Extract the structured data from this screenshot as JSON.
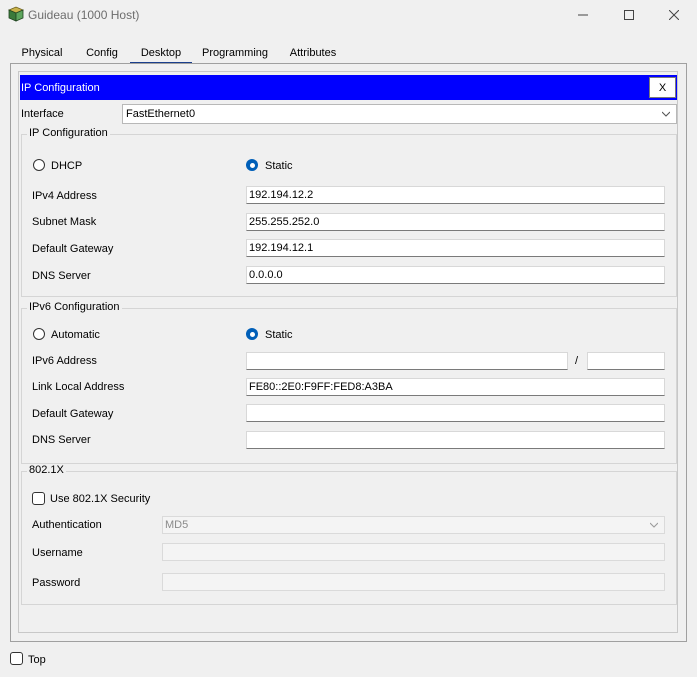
{
  "window": {
    "title": "Guideau (1000 Host)",
    "minimize_icon": "minimize-icon",
    "maximize_icon": "maximize-icon",
    "close_icon": "close-icon"
  },
  "tabs": [
    {
      "label": "Physical",
      "active": false
    },
    {
      "label": "Config",
      "active": false
    },
    {
      "label": "Desktop",
      "active": true
    },
    {
      "label": "Programming",
      "active": false
    },
    {
      "label": "Attributes",
      "active": false
    }
  ],
  "panel": {
    "header_title": "IP Configuration",
    "close_label": "X",
    "header_color": "#0000ff"
  },
  "interface": {
    "label": "Interface",
    "value": "FastEthernet0"
  },
  "ipv4": {
    "group_title": "IP Configuration",
    "dhcp_label": "DHCP",
    "static_label": "Static",
    "mode": "static",
    "address_label": "IPv4 Address",
    "address_value": "192.194.12.2",
    "mask_label": "Subnet Mask",
    "mask_value": "255.255.252.0",
    "gateway_label": "Default Gateway",
    "gateway_value": "192.194.12.1",
    "dns_label": "DNS Server",
    "dns_value": "0.0.0.0"
  },
  "ipv6": {
    "group_title": "IPv6 Configuration",
    "auto_label": "Automatic",
    "static_label": "Static",
    "mode": "static",
    "address_label": "IPv6 Address",
    "address_value": "",
    "slash": "/",
    "prefix_value": "",
    "link_local_label": "Link Local Address",
    "link_local_value": "FE80::2E0:F9FF:FED8:A3BA",
    "gateway_label": "Default Gateway",
    "gateway_value": "",
    "dns_label": "DNS Server",
    "dns_value": ""
  },
  "dot1x": {
    "group_title": "802.1X",
    "use_label": "Use 802.1X Security",
    "use_checked": false,
    "auth_label": "Authentication",
    "auth_value": "MD5",
    "username_label": "Username",
    "username_value": "",
    "password_label": "Password",
    "password_value": ""
  },
  "footer": {
    "top_label": "Top",
    "top_checked": false
  },
  "colors": {
    "accent": "#005fb8",
    "tab_underline": "#1a3f8c"
  }
}
